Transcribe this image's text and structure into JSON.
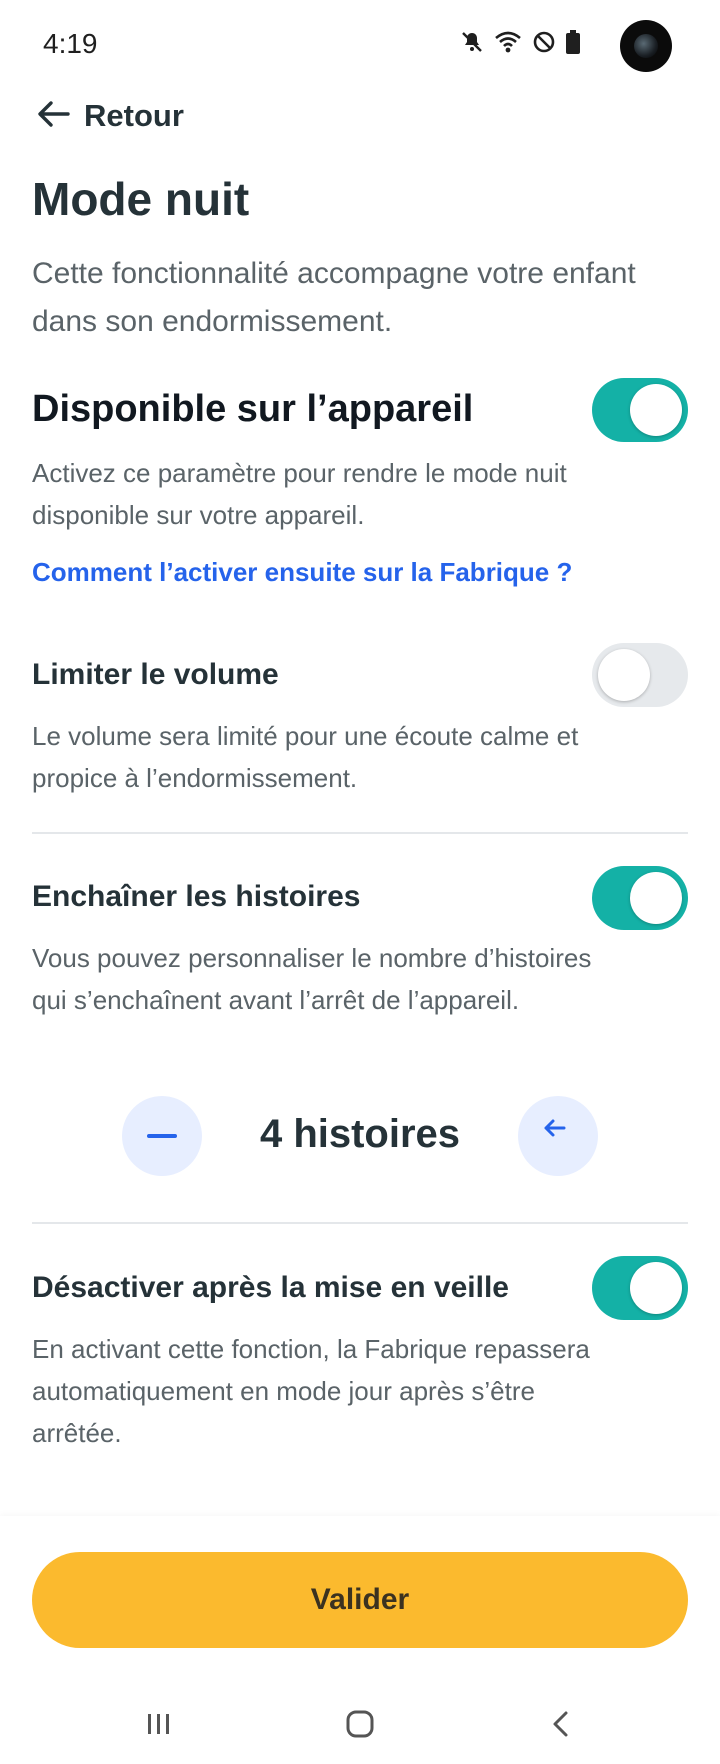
{
  "status_bar": {
    "time": "4:19",
    "icons": [
      "mute-icon",
      "wifi-icon",
      "do-not-disturb-icon",
      "battery-icon"
    ]
  },
  "header": {
    "back_label": "Retour"
  },
  "page": {
    "title": "Mode nuit",
    "intro": "Cette fonctionnalité accompagne votre enfant dans son endormissement."
  },
  "settings": {
    "available": {
      "title": "Disponible sur l’appareil",
      "description": "Activez ce paramètre pour rendre le mode nuit disponible sur votre appareil.",
      "link": "Comment l’activer ensuite sur la Fabrique ?",
      "enabled": true
    },
    "limit_volume": {
      "title": "Limiter le volume",
      "description": "Le volume sera limité pour une écoute calme et propice à l’endormissement.",
      "enabled": false
    },
    "chain_stories": {
      "title": "Enchaîner les histoires",
      "description": "Vous pouvez personnaliser le nombre d’histoires qui s’enchaînent avant l’arrêt de l’appareil.",
      "enabled": true,
      "count_label": "4 histoires"
    },
    "disable_after_sleep": {
      "title": "Désactiver après la mise en veille",
      "description": "En activant cette fonction, la Fabrique repassera automatiquement en mode jour après s’être arrêtée.",
      "enabled": true
    }
  },
  "footer": {
    "validate_label": "Valider"
  },
  "colors": {
    "toggle_on": "#14b1a6",
    "toggle_off": "#e6e9ec",
    "link": "#2563eb",
    "primary_button": "#fbba2e",
    "stepper_bg": "#e7eeff"
  }
}
